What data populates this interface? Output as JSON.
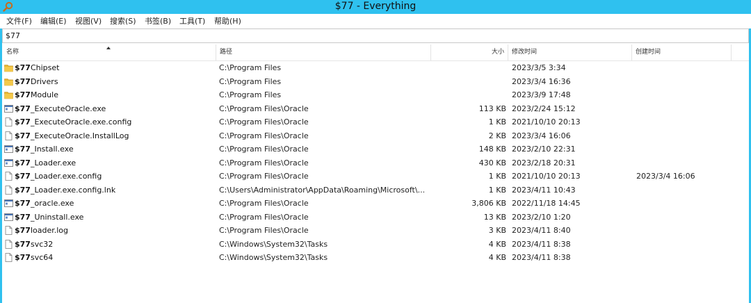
{
  "window": {
    "title": "$77 - Everything"
  },
  "menu": [
    "文件(F)",
    "编辑(E)",
    "视图(V)",
    "搜索(S)",
    "书签(B)",
    "工具(T)",
    "帮助(H)"
  ],
  "search": {
    "value": "$77"
  },
  "columns": {
    "name": "名称",
    "path": "路径",
    "size": "大小",
    "modified": "修改时间",
    "created": "创建时间"
  },
  "rows": [
    {
      "icon": "folder-icon",
      "bold": "$77",
      "rest": "Chipset",
      "path": "C:\\Program Files",
      "size": "",
      "modified": "2023/3/5 3:34",
      "created": ""
    },
    {
      "icon": "folder-icon",
      "bold": "$77",
      "rest": "Drivers",
      "path": "C:\\Program Files",
      "size": "",
      "modified": "2023/3/4 16:36",
      "created": ""
    },
    {
      "icon": "folder-icon",
      "bold": "$77",
      "rest": "Module",
      "path": "C:\\Program Files",
      "size": "",
      "modified": "2023/3/9 17:48",
      "created": ""
    },
    {
      "icon": "exe-icon",
      "bold": "$77",
      "rest": "_ExecuteOracle.exe",
      "path": "C:\\Program Files\\Oracle",
      "size": "113 KB",
      "modified": "2023/2/24 15:12",
      "created": ""
    },
    {
      "icon": "file-icon",
      "bold": "$77",
      "rest": "_ExecuteOracle.exe.config",
      "path": "C:\\Program Files\\Oracle",
      "size": "1 KB",
      "modified": "2021/10/10 20:13",
      "created": ""
    },
    {
      "icon": "file-icon",
      "bold": "$77",
      "rest": "_ExecuteOracle.InstallLog",
      "path": "C:\\Program Files\\Oracle",
      "size": "2 KB",
      "modified": "2023/3/4 16:06",
      "created": ""
    },
    {
      "icon": "exe-icon",
      "bold": "$77",
      "rest": "_Install.exe",
      "path": "C:\\Program Files\\Oracle",
      "size": "148 KB",
      "modified": "2023/2/10 22:31",
      "created": ""
    },
    {
      "icon": "exe-icon",
      "bold": "$77",
      "rest": "_Loader.exe",
      "path": "C:\\Program Files\\Oracle",
      "size": "430 KB",
      "modified": "2023/2/18 20:31",
      "created": ""
    },
    {
      "icon": "file-icon",
      "bold": "$77",
      "rest": "_Loader.exe.config",
      "path": "C:\\Program Files\\Oracle",
      "size": "1 KB",
      "modified": "2021/10/10 20:13",
      "created": "2023/3/4 16:06"
    },
    {
      "icon": "file-icon",
      "bold": "$77",
      "rest": "_Loader.exe.config.lnk",
      "path": "C:\\Users\\Administrator\\AppData\\Roaming\\Microsoft\\...",
      "size": "1 KB",
      "modified": "2023/4/11 10:43",
      "created": ""
    },
    {
      "icon": "exe-icon",
      "bold": "$77",
      "rest": "_oracle.exe",
      "path": "C:\\Program Files\\Oracle",
      "size": "3,806 KB",
      "modified": "2022/11/18 14:45",
      "created": ""
    },
    {
      "icon": "exe-icon",
      "bold": "$77",
      "rest": "_Uninstall.exe",
      "path": "C:\\Program Files\\Oracle",
      "size": "13 KB",
      "modified": "2023/2/10 1:20",
      "created": ""
    },
    {
      "icon": "file-icon",
      "bold": "$77",
      "rest": "loader.log",
      "path": "C:\\Program Files\\Oracle",
      "size": "3 KB",
      "modified": "2023/4/11 8:40",
      "created": ""
    },
    {
      "icon": "file-icon",
      "bold": "$77",
      "rest": "svc32",
      "path": "C:\\Windows\\System32\\Tasks",
      "size": "4 KB",
      "modified": "2023/4/11 8:38",
      "created": ""
    },
    {
      "icon": "file-icon",
      "bold": "$77",
      "rest": "svc64",
      "path": "C:\\Windows\\System32\\Tasks",
      "size": "4 KB",
      "modified": "2023/4/11 8:38",
      "created": ""
    }
  ],
  "colors": {
    "titlebar": "#2fc1ef",
    "folder": "#e8b430"
  }
}
